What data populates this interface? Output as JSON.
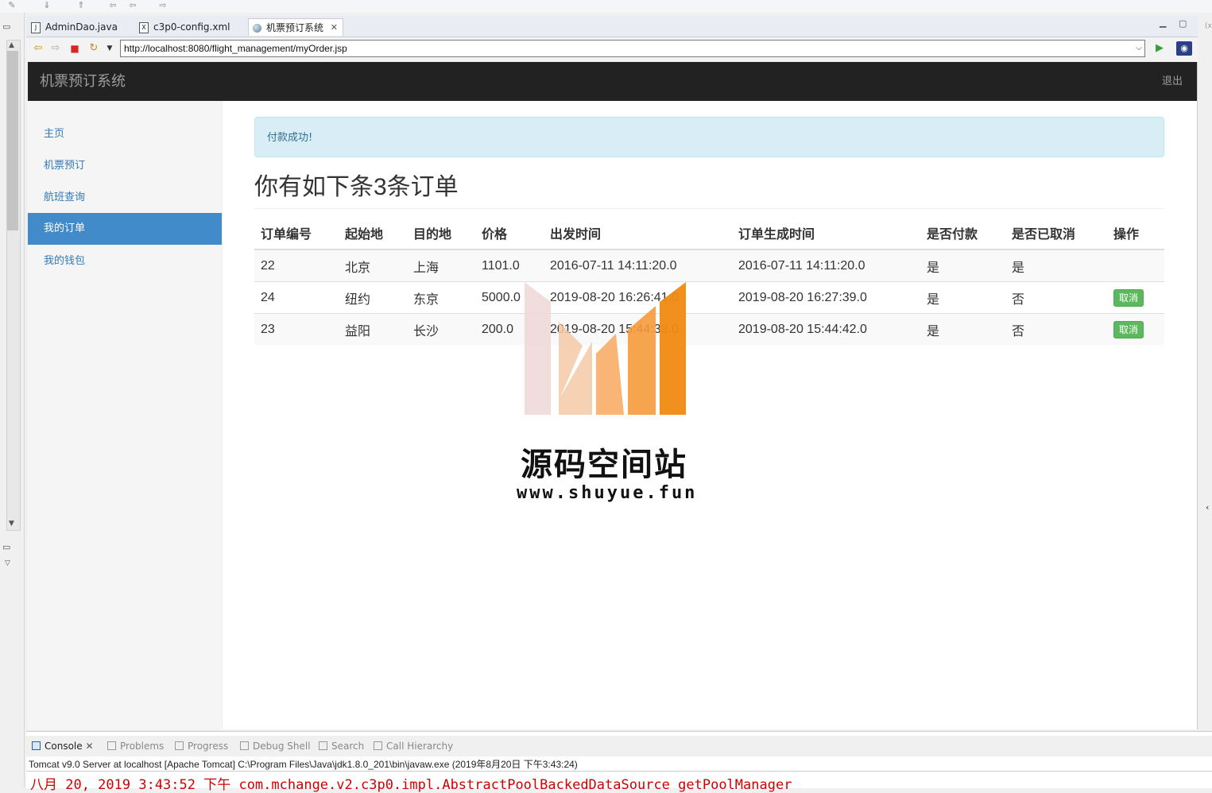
{
  "editor_tabs": [
    {
      "label": "AdminDao.java",
      "icon": "java-file-icon",
      "active": false
    },
    {
      "label": "c3p0-config.xml",
      "icon": "xml-file-icon",
      "active": false
    },
    {
      "label": "机票预订系统",
      "icon": "globe-icon",
      "active": true
    }
  ],
  "browser": {
    "url": "http://localhost:8080/flight_management/myOrder.jsp"
  },
  "app": {
    "brand": "机票预订系统",
    "logout": "退出"
  },
  "sidebar": {
    "items": [
      {
        "label": "主页",
        "active": false
      },
      {
        "label": "机票预订",
        "active": false
      },
      {
        "label": "航班查询",
        "active": false
      },
      {
        "label": "我的订单",
        "active": true
      },
      {
        "label": "我的钱包",
        "active": false
      }
    ]
  },
  "main": {
    "alert": "付款成功!",
    "heading": "你有如下条3条订单",
    "table": {
      "headers": [
        "订单编号",
        "起始地",
        "目的地",
        "价格",
        "出发时间",
        "订单生成时间",
        "是否付款",
        "是否已取消",
        "操作"
      ],
      "rows": [
        [
          "22",
          "北京",
          "上海",
          "1101.0",
          "2016-07-11 14:11:20.0",
          "2016-07-11 14:11:20.0",
          "是",
          "是",
          ""
        ],
        [
          "24",
          "纽约",
          "东京",
          "5000.0",
          "2019-08-20 16:26:41.0",
          "2019-08-20 16:27:39.0",
          "是",
          "否",
          "取消"
        ],
        [
          "23",
          "益阳",
          "长沙",
          "200.0",
          "2019-08-20 15:44:33.0",
          "2019-08-20 15:44:42.0",
          "是",
          "否",
          "取消"
        ]
      ]
    }
  },
  "watermark": {
    "title": "源码空间站",
    "url": "www.shuyue.fun"
  },
  "console": {
    "tabs": [
      "Console",
      "Problems",
      "Progress",
      "Debug Shell",
      "Search",
      "Call Hierarchy"
    ],
    "description": "Tomcat v9.0 Server at localhost [Apache Tomcat] C:\\Program Files\\Java\\jdk1.8.0_201\\bin\\javaw.exe (2019年8月20日 下午3:43:24)",
    "log_line": "八月 20, 2019 3:43:52 下午 com.mchange.v2.c3p0.impl.AbstractPoolBackedDataSource getPoolManager"
  },
  "colors": {
    "navbar": "#222222",
    "sidebar_active": "#428bca",
    "alert_bg": "#d9edf7",
    "cancel_button": "#5cb85c",
    "console_error": "#d00000"
  }
}
